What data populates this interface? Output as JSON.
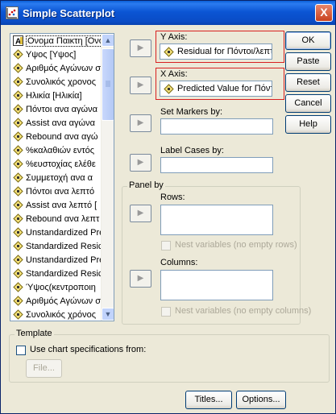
{
  "window": {
    "title": "Simple Scatterplot",
    "close_glyph": "X"
  },
  "variables": [
    {
      "label": "Ονομα Παικτη [Ονο",
      "icon": "nominal-text-icon"
    },
    {
      "label": "Υψος [Υψος]",
      "icon": "scale-icon"
    },
    {
      "label": "Αριθμός Αγώνων σ",
      "icon": "scale-icon"
    },
    {
      "label": "Συνολικός χρονος",
      "icon": "scale-icon"
    },
    {
      "label": "Ηλικία [Ηλικία]",
      "icon": "scale-icon"
    },
    {
      "label": "Πόντοι ανα αγώνα",
      "icon": "scale-icon"
    },
    {
      "label": "Assist ανα αγώνα",
      "icon": "scale-icon"
    },
    {
      "label": "Rebound ανα αγώ",
      "icon": "scale-icon"
    },
    {
      "label": "%καλαθιών εντός",
      "icon": "scale-icon"
    },
    {
      "label": "%ευστοχίας ελέθε",
      "icon": "scale-icon"
    },
    {
      "label": "Συμμετοχή ανα α",
      "icon": "scale-icon"
    },
    {
      "label": "Πόντοι ανα λεπτό",
      "icon": "scale-icon"
    },
    {
      "label": "Assist ανα λεπτό [",
      "icon": "scale-icon"
    },
    {
      "label": "Rebound ανα λεπτ",
      "icon": "scale-icon"
    },
    {
      "label": "Unstandardized Pre",
      "icon": "scale-icon"
    },
    {
      "label": "Standardized Resic",
      "icon": "scale-icon"
    },
    {
      "label": "Unstandardized Pre",
      "icon": "scale-icon"
    },
    {
      "label": "Standardized Resic",
      "icon": "scale-icon"
    },
    {
      "label": "Ύψος(κεντροποιη",
      "icon": "scale-icon"
    },
    {
      "label": "Αριθμός Αγώνων σ",
      "icon": "scale-icon"
    },
    {
      "label": "Συνολικός χρόνος",
      "icon": "scale-icon"
    }
  ],
  "scroll": {
    "up": "▲",
    "down": "▼"
  },
  "move_arrow": "▶",
  "y_axis": {
    "label": "Y Axis:",
    "value": "Residual for Πόντοι/λεπτ"
  },
  "x_axis": {
    "label": "X Axis:",
    "value": "Predicted Value for Πόντ"
  },
  "set_markers": {
    "label": "Set Markers by:",
    "value": ""
  },
  "label_cases": {
    "label": "Label Cases by:",
    "value": ""
  },
  "panel_by": {
    "title": "Panel by",
    "rows_label": "Rows:",
    "rows_nest": "Nest variables (no empty rows)",
    "columns_label": "Columns:",
    "columns_nest": "Nest variables (no empty columns)"
  },
  "template": {
    "title": "Template",
    "use_spec": "Use chart specifications from:",
    "file_button": "File..."
  },
  "buttons": {
    "ok": "OK",
    "paste": "Paste",
    "reset": "Reset",
    "cancel": "Cancel",
    "help": "Help",
    "titles": "Titles...",
    "options": "Options..."
  },
  "colors": {
    "titlebar": "#0a4cc6",
    "highlight_box": "#d82020",
    "dialog_bg": "#ece9d8"
  }
}
